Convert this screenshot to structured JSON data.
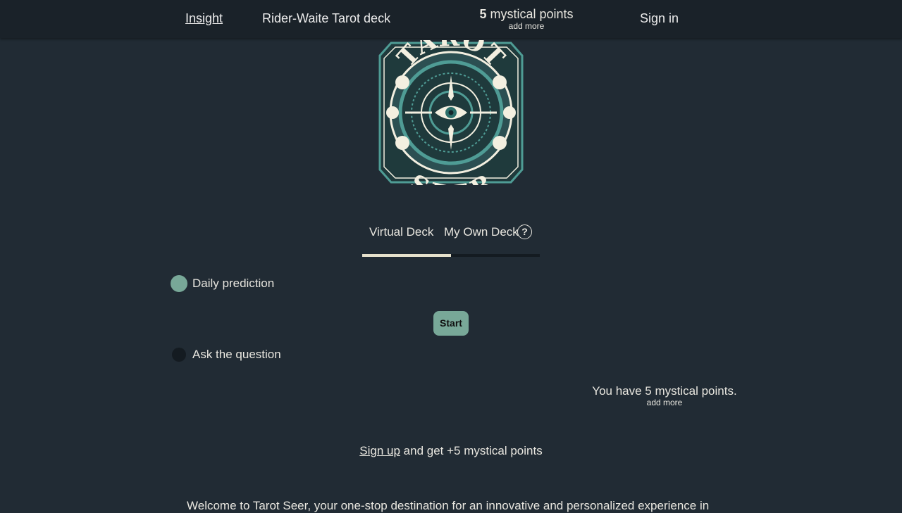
{
  "nav": {
    "insight": "Insight",
    "deck": "Rider-Waite Tarot deck",
    "points_count": "5",
    "points_label": "mystical points",
    "add_more": "add more",
    "sign_in": "Sign in"
  },
  "logo": {
    "top_text": "TAROT",
    "bottom_text": "SEER"
  },
  "tabs": {
    "virtual": "Virtual Deck",
    "own": "My Own Deck",
    "help": "?",
    "active": "virtual"
  },
  "options": {
    "daily": "Daily prediction",
    "ask": "Ask the question",
    "selected": "daily"
  },
  "start_button": "Start",
  "points_summary": {
    "text": "You have 5 mystical points.",
    "add_more": "add more"
  },
  "signup": {
    "link": "Sign up",
    "rest": " and get +5 mystical points"
  },
  "welcome_text": "Welcome to Tarot Seer, your one-stop destination for an innovative and personalized experience in",
  "colors": {
    "background": "#212b34",
    "topbar": "#1a2229",
    "accent": "#78a898",
    "logo_teal": "#4f9c95",
    "logo_cream": "#f3efe0"
  }
}
